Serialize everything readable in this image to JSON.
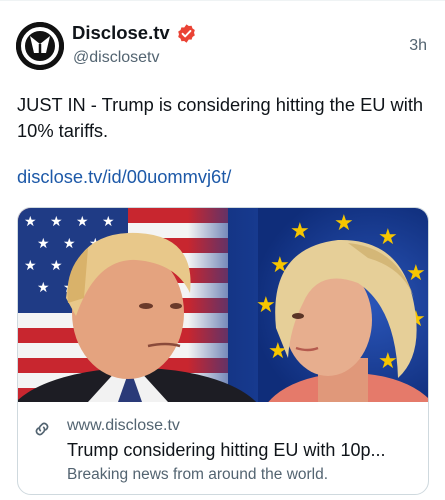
{
  "post": {
    "author": {
      "display_name": "Disclose.tv",
      "handle": "@disclosetv",
      "verified": true,
      "avatar_icon": "disclose-logo-icon"
    },
    "time": "3h",
    "text": "JUST IN - Trump is considering hitting the EU with 10% tariffs.",
    "link_text": "disclose.tv/id/00uommvj6t/"
  },
  "card": {
    "domain": "www.disclose.tv",
    "title": "Trump considering hitting EU with 10p...",
    "description": "Breaking news from around the world.",
    "link_icon": "link-icon"
  },
  "colors": {
    "text": "#0f1419",
    "secondary": "#536471",
    "link": "#1d59a8",
    "verified": "#ea4335",
    "border": "#cfd9de"
  }
}
